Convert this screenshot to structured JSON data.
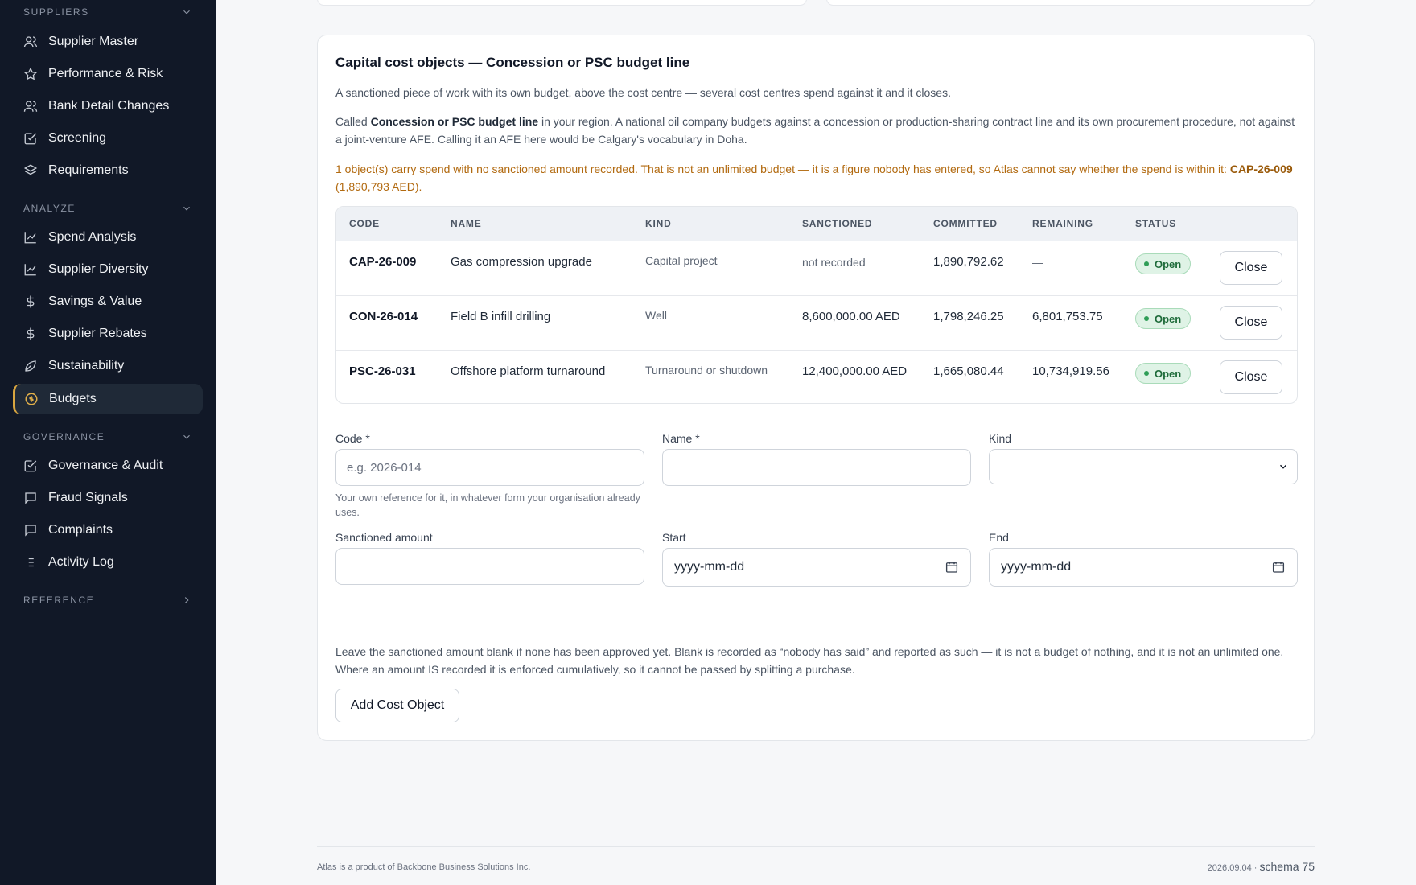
{
  "sidebar": {
    "sections": [
      {
        "title": "SUPPLIERS",
        "items": [
          {
            "label": "Supplier Master",
            "icon": "users-icon"
          },
          {
            "label": "Performance & Risk",
            "icon": "star-icon"
          },
          {
            "label": "Bank Detail Changes",
            "icon": "users-icon"
          },
          {
            "label": "Screening",
            "icon": "checkbox-icon"
          },
          {
            "label": "Requirements",
            "icon": "layers-icon"
          }
        ]
      },
      {
        "title": "ANALYZE",
        "items": [
          {
            "label": "Spend Analysis",
            "icon": "line-chart-icon"
          },
          {
            "label": "Supplier Diversity",
            "icon": "line-chart-icon"
          },
          {
            "label": "Savings & Value",
            "icon": "dollar-icon"
          },
          {
            "label": "Supplier Rebates",
            "icon": "dollar-icon"
          },
          {
            "label": "Sustainability",
            "icon": "leaf-icon"
          },
          {
            "label": "Budgets",
            "icon": "coin-icon",
            "active": true
          }
        ]
      },
      {
        "title": "GOVERNANCE",
        "items": [
          {
            "label": "Governance & Audit",
            "icon": "checkbox-icon"
          },
          {
            "label": "Fraud Signals",
            "icon": "message-icon"
          },
          {
            "label": "Complaints",
            "icon": "message-icon"
          },
          {
            "label": "Activity Log",
            "icon": "list-icon"
          }
        ]
      },
      {
        "title": "REFERENCE",
        "items": []
      }
    ]
  },
  "card": {
    "title": "Capital cost objects — Concession or PSC budget line",
    "intro": "A sanctioned piece of work with its own budget, above the cost centre — several cost centres spend against it and it closes.",
    "region_prefix": "Called ",
    "region_term": "Concession or PSC budget line",
    "region_suffix": " in your region. A national oil company budgets against a concession or production-sharing contract line and its own procurement procedure, not against a joint-venture AFE. Calling it an AFE here would be Calgary's vocabulary in Doha.",
    "warning_text": "1 object(s) carry spend with no sanctioned amount recorded. That is not an unlimited budget — it is a figure nobody has entered, so Atlas cannot say whether the spend is within it: ",
    "warning_code": "CAP-26-009",
    "warning_amount": " (1,890,793 AED)."
  },
  "table": {
    "headers": [
      "CODE",
      "NAME",
      "KIND",
      "SANCTIONED",
      "COMMITTED",
      "REMAINING",
      "STATUS"
    ],
    "rows": [
      {
        "code": "CAP-26-009",
        "name": "Gas compression upgrade",
        "kind": "Capital project",
        "sanctioned": "not recorded",
        "committed": "1,890,792.62",
        "remaining": "—",
        "status": "Open",
        "action": "Close"
      },
      {
        "code": "CON-26-014",
        "name": "Field B infill drilling",
        "kind": "Well",
        "sanctioned": "8,600,000.00 AED",
        "committed": "1,798,246.25",
        "remaining": "6,801,753.75",
        "status": "Open",
        "action": "Close"
      },
      {
        "code": "PSC-26-031",
        "name": "Offshore platform turnaround",
        "kind": "Turnaround or shutdown",
        "sanctioned": "12,400,000.00 AED",
        "committed": "1,665,080.44",
        "remaining": "10,734,919.56",
        "status": "Open",
        "action": "Close"
      }
    ]
  },
  "form": {
    "code_label": "Code *",
    "code_placeholder": "e.g. 2026-014",
    "code_help": "Your own reference for it, in whatever form your organisation already uses.",
    "name_label": "Name *",
    "kind_label": "Kind",
    "sanctioned_label": "Sanctioned amount",
    "start_label": "Start",
    "start_placeholder": "yyyy-mm-dd",
    "end_label": "End",
    "end_placeholder": "yyyy-mm-dd",
    "note": "Leave the sanctioned amount blank if none has been approved yet. Blank is recorded as “nobody has said” and reported as such — it is not a budget of nothing, and it is not an unlimited one. Where an amount IS recorded it is enforced cumulatively, so it cannot be passed by splitting a purchase.",
    "submit_label": "Add Cost Object"
  },
  "footer": {
    "left": "Atlas is a product of Backbone Business Solutions Inc.",
    "version": "2026.09.04 · ",
    "schema": "schema 75"
  },
  "colors": {
    "sidebar_bg": "#111827",
    "active_accent": "#d9a640",
    "warning_text": "#b26a10",
    "status_open_bg": "#dff3e6",
    "status_open_text": "#1e6b3a"
  }
}
